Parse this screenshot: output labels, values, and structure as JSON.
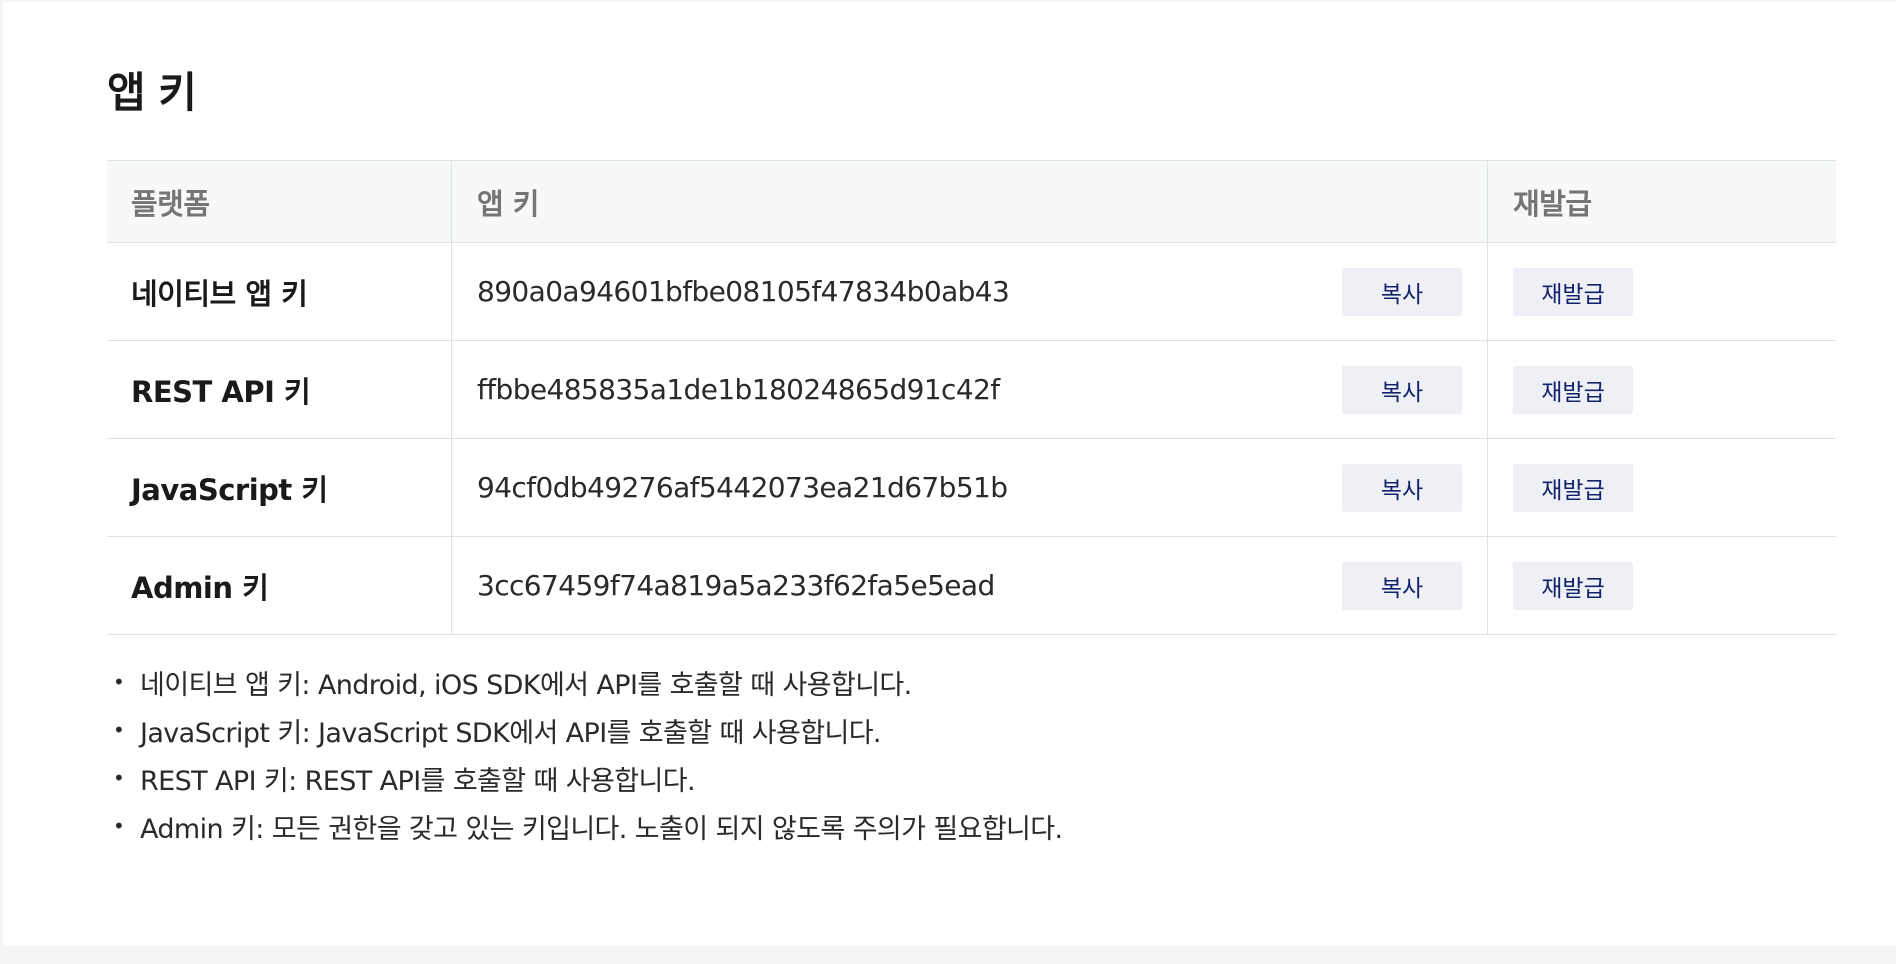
{
  "page": {
    "title": "앱 키"
  },
  "table": {
    "headers": {
      "platform": "플랫폼",
      "app_key": "앱 키",
      "reissue": "재발급"
    },
    "rows": [
      {
        "platform": "네이티브 앱 키",
        "key": "890a0a94601bfbe08105f47834b0ab43",
        "copy_label": "복사",
        "reissue_label": "재발급"
      },
      {
        "platform": "REST API 키",
        "key": "ffbbe485835a1de1b18024865d91c42f",
        "copy_label": "복사",
        "reissue_label": "재발급"
      },
      {
        "platform": "JavaScript 키",
        "key": "94cf0db49276af5442073ea21d67b51b",
        "copy_label": "복사",
        "reissue_label": "재발급"
      },
      {
        "platform": "Admin 키",
        "key": "3cc67459f74a819a5a233f62fa5e5ead",
        "copy_label": "복사",
        "reissue_label": "재발급"
      }
    ]
  },
  "notes": [
    "네이티브 앱 키: Android, iOS SDK에서 API를 호출할 때 사용합니다.",
    "JavaScript 키: JavaScript SDK에서 API를 호출할 때 사용합니다.",
    "REST API 키: REST API를 호출할 때 사용합니다.",
    "Admin 키: 모든 권한을 갖고 있는 키입니다. 노출이 되지 않도록 주의가 필요합니다."
  ],
  "colors": {
    "button_bg": "#eff0f6",
    "button_text": "#13236b",
    "header_bg": "#f7f8f8",
    "border": "#dfe2e2"
  }
}
